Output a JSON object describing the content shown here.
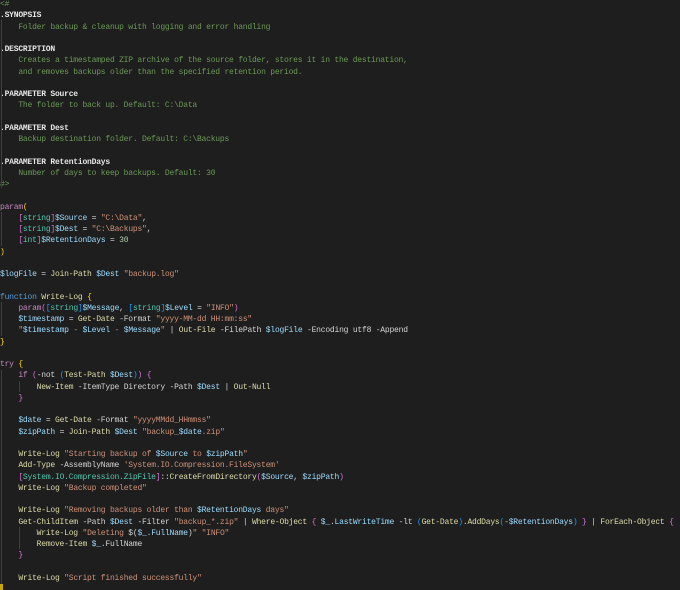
{
  "theme": {
    "background": "#1e1e1e",
    "comment": "#6a9955",
    "keyword": "#c586c0",
    "variable": "#9cdcfe",
    "string": "#ce9178",
    "function": "#dcdcaa"
  },
  "code": {
    "language": "PowerShell",
    "lines": [
      [
        [
          "<#",
          "c"
        ]
      ],
      [
        [
          ".SYNOPSIS",
          "d"
        ]
      ],
      [
        [
          "    Folder backup & cleanup with logging and error handling",
          "c"
        ]
      ],
      [],
      [
        [
          ".DESCRIPTION",
          "d"
        ]
      ],
      [
        [
          "    Creates a timestamped ZIP archive of the source folder, stores it in the destination,",
          "c"
        ]
      ],
      [
        [
          "    and removes backups older than the specified retention period.",
          "c"
        ]
      ],
      [],
      [
        [
          ".PARAMETER Source",
          "d"
        ]
      ],
      [
        [
          "    The folder to back up. Default: C:\\Data",
          "c"
        ]
      ],
      [],
      [
        [
          ".PARAMETER Dest",
          "d"
        ]
      ],
      [
        [
          "    Backup destination folder. Default: C:\\Backups",
          "c"
        ]
      ],
      [],
      [
        [
          ".PARAMETER RetentionDays",
          "d"
        ]
      ],
      [
        [
          "    Number of days to keep backups. Default: 30",
          "c"
        ]
      ],
      [
        [
          "#>",
          "c"
        ]
      ],
      [],
      [
        [
          "param",
          "k"
        ],
        [
          "(",
          "y"
        ]
      ],
      [
        [
          "    ",
          "o"
        ],
        [
          "[",
          "p"
        ],
        [
          "string",
          "t"
        ],
        [
          "]",
          "p"
        ],
        [
          "$Source",
          "v"
        ],
        [
          " = ",
          "o"
        ],
        [
          "\"C:\\Data\"",
          "s"
        ],
        [
          ",",
          "o"
        ]
      ],
      [
        [
          "    ",
          "o"
        ],
        [
          "[",
          "p"
        ],
        [
          "string",
          "t"
        ],
        [
          "]",
          "p"
        ],
        [
          "$Dest",
          "v"
        ],
        [
          " = ",
          "o"
        ],
        [
          "\"C:\\Backups\"",
          "s"
        ],
        [
          ",",
          "o"
        ]
      ],
      [
        [
          "    ",
          "o"
        ],
        [
          "[",
          "p"
        ],
        [
          "int",
          "t"
        ],
        [
          "]",
          "p"
        ],
        [
          "$RetentionDays",
          "v"
        ],
        [
          " = ",
          "o"
        ],
        [
          "30",
          "n"
        ]
      ],
      [
        [
          ")",
          "y"
        ]
      ],
      [],
      [
        [
          "$logFile",
          "v"
        ],
        [
          " = ",
          "o"
        ],
        [
          "Join-Path",
          "f"
        ],
        [
          " ",
          "o"
        ],
        [
          "$Dest",
          "v"
        ],
        [
          " ",
          "o"
        ],
        [
          "\"backup.log\"",
          "s"
        ]
      ],
      [],
      [
        [
          "function",
          "kb"
        ],
        [
          " ",
          "o"
        ],
        [
          "Write-Log",
          "f"
        ],
        [
          " ",
          "o"
        ],
        [
          "{",
          "y"
        ]
      ],
      [
        [
          "    ",
          "o"
        ],
        [
          "param",
          "k"
        ],
        [
          "(",
          "p"
        ],
        [
          "[",
          "b"
        ],
        [
          "string",
          "t"
        ],
        [
          "]",
          "b"
        ],
        [
          "$Message",
          "v"
        ],
        [
          ", ",
          "o"
        ],
        [
          "[",
          "b"
        ],
        [
          "string",
          "t"
        ],
        [
          "]",
          "b"
        ],
        [
          "$Level",
          "v"
        ],
        [
          " = ",
          "o"
        ],
        [
          "\"INFO\"",
          "s"
        ],
        [
          ")",
          "p"
        ]
      ],
      [
        [
          "    ",
          "o"
        ],
        [
          "$timestamp",
          "v"
        ],
        [
          " = ",
          "o"
        ],
        [
          "Get-Date",
          "f"
        ],
        [
          " -Format ",
          "o"
        ],
        [
          "\"yyyy-MM-dd HH:mm:ss\"",
          "s"
        ]
      ],
      [
        [
          "    ",
          "o"
        ],
        [
          "\"",
          "s"
        ],
        [
          "$timestamp",
          "v"
        ],
        [
          " - ",
          "s"
        ],
        [
          "$Level",
          "v"
        ],
        [
          " - ",
          "s"
        ],
        [
          "$Message",
          "v"
        ],
        [
          "\"",
          "s"
        ],
        [
          " | ",
          "o"
        ],
        [
          "Out-File",
          "f"
        ],
        [
          " -FilePath ",
          "o"
        ],
        [
          "$logFile",
          "v"
        ],
        [
          " -Encoding utf8 -Append",
          "o"
        ]
      ],
      [
        [
          "}",
          "y"
        ]
      ],
      [],
      [
        [
          "try",
          "k"
        ],
        [
          " ",
          "o"
        ],
        [
          "{",
          "y"
        ]
      ],
      [
        [
          "    ",
          "o"
        ],
        [
          "if",
          "k"
        ],
        [
          " ",
          "o"
        ],
        [
          "(",
          "p"
        ],
        [
          "-not ",
          "o"
        ],
        [
          "(",
          "b"
        ],
        [
          "Test-Path",
          "f"
        ],
        [
          " ",
          "o"
        ],
        [
          "$Dest",
          "v"
        ],
        [
          ")",
          "b"
        ],
        [
          ")",
          "p"
        ],
        [
          " ",
          "o"
        ],
        [
          "{",
          "p"
        ]
      ],
      [
        [
          "        ",
          "o"
        ],
        [
          "New-Item",
          "f"
        ],
        [
          " -ItemType Directory -Path ",
          "o"
        ],
        [
          "$Dest",
          "v"
        ],
        [
          " | ",
          "o"
        ],
        [
          "Out-Null",
          "f"
        ]
      ],
      [
        [
          "    ",
          "o"
        ],
        [
          "}",
          "p"
        ]
      ],
      [],
      [
        [
          "    ",
          "o"
        ],
        [
          "$date",
          "v"
        ],
        [
          " = ",
          "o"
        ],
        [
          "Get-Date",
          "f"
        ],
        [
          " -Format ",
          "o"
        ],
        [
          "\"yyyyMMdd_HHmmss\"",
          "s"
        ]
      ],
      [
        [
          "    ",
          "o"
        ],
        [
          "$zipPath",
          "v"
        ],
        [
          " = ",
          "o"
        ],
        [
          "Join-Path",
          "f"
        ],
        [
          " ",
          "o"
        ],
        [
          "$Dest",
          "v"
        ],
        [
          " ",
          "o"
        ],
        [
          "\"backup_",
          "s"
        ],
        [
          "$date",
          "v"
        ],
        [
          ".zip\"",
          "s"
        ]
      ],
      [],
      [
        [
          "    ",
          "o"
        ],
        [
          "Write-Log",
          "f"
        ],
        [
          " ",
          "o"
        ],
        [
          "\"Starting backup of ",
          "s"
        ],
        [
          "$Source",
          "v"
        ],
        [
          " to ",
          "s"
        ],
        [
          "$zipPath",
          "v"
        ],
        [
          "\"",
          "s"
        ]
      ],
      [
        [
          "    ",
          "o"
        ],
        [
          "Add-Type",
          "f"
        ],
        [
          " -AssemblyName ",
          "o"
        ],
        [
          "'System.IO.Compression.FileSystem'",
          "s"
        ]
      ],
      [
        [
          "    ",
          "o"
        ],
        [
          "[",
          "p"
        ],
        [
          "System.IO.Compression.ZipFile",
          "t"
        ],
        [
          "]",
          "p"
        ],
        [
          "::",
          "o"
        ],
        [
          "CreateFromDirectory",
          "f"
        ],
        [
          "(",
          "p"
        ],
        [
          "$Source",
          "v"
        ],
        [
          ", ",
          "o"
        ],
        [
          "$zipPath",
          "v"
        ],
        [
          ")",
          "p"
        ]
      ],
      [
        [
          "    ",
          "o"
        ],
        [
          "Write-Log",
          "f"
        ],
        [
          " ",
          "o"
        ],
        [
          "\"Backup completed\"",
          "s"
        ]
      ],
      [],
      [
        [
          "    ",
          "o"
        ],
        [
          "Write-Log",
          "f"
        ],
        [
          " ",
          "o"
        ],
        [
          "\"Removing backups older than ",
          "s"
        ],
        [
          "$RetentionDays",
          "v"
        ],
        [
          " days\"",
          "s"
        ]
      ],
      [
        [
          "    ",
          "o"
        ],
        [
          "Get-ChildItem",
          "f"
        ],
        [
          " -Path ",
          "o"
        ],
        [
          "$Dest",
          "v"
        ],
        [
          " -Filter ",
          "o"
        ],
        [
          "\"backup_*.zip\"",
          "s"
        ],
        [
          " | ",
          "o"
        ],
        [
          "Where-Object",
          "f"
        ],
        [
          " ",
          "o"
        ],
        [
          "{",
          "p"
        ],
        [
          " ",
          "o"
        ],
        [
          "$_",
          "v"
        ],
        [
          ".",
          "o"
        ],
        [
          "LastWriteTime",
          "v"
        ],
        [
          " -lt ",
          "o"
        ],
        [
          "(",
          "b"
        ],
        [
          "Get-Date",
          "f"
        ],
        [
          ")",
          "b"
        ],
        [
          ".",
          "o"
        ],
        [
          "AddDays",
          "f"
        ],
        [
          "(",
          "b"
        ],
        [
          "-",
          "o"
        ],
        [
          "$RetentionDays",
          "v"
        ],
        [
          ")",
          "b"
        ],
        [
          " ",
          "o"
        ],
        [
          "}",
          "p"
        ],
        [
          " | ",
          "o"
        ],
        [
          "ForEach-Object",
          "f"
        ],
        [
          " ",
          "o"
        ],
        [
          "{",
          "p"
        ]
      ],
      [
        [
          "        ",
          "o"
        ],
        [
          "Write-Log",
          "f"
        ],
        [
          " ",
          "o"
        ],
        [
          "\"Deleting ",
          "s"
        ],
        [
          "$(",
          "o"
        ],
        [
          "$_",
          "v"
        ],
        [
          ".FullName",
          "v"
        ],
        [
          ")",
          "o"
        ],
        [
          "\"",
          "s"
        ],
        [
          " ",
          "o"
        ],
        [
          "\"INFO\"",
          "s"
        ]
      ],
      [
        [
          "        ",
          "o"
        ],
        [
          "Remove-Item",
          "f"
        ],
        [
          " ",
          "o"
        ],
        [
          "$_",
          "v"
        ],
        [
          ".FullName",
          "o"
        ]
      ],
      [
        [
          "    ",
          "o"
        ],
        [
          "}",
          "p"
        ]
      ],
      [],
      [
        [
          "    ",
          "o"
        ],
        [
          "Write-Log",
          "f"
        ],
        [
          " ",
          "o"
        ],
        [
          "\"Script finished successfully\"",
          "s"
        ]
      ]
    ]
  }
}
